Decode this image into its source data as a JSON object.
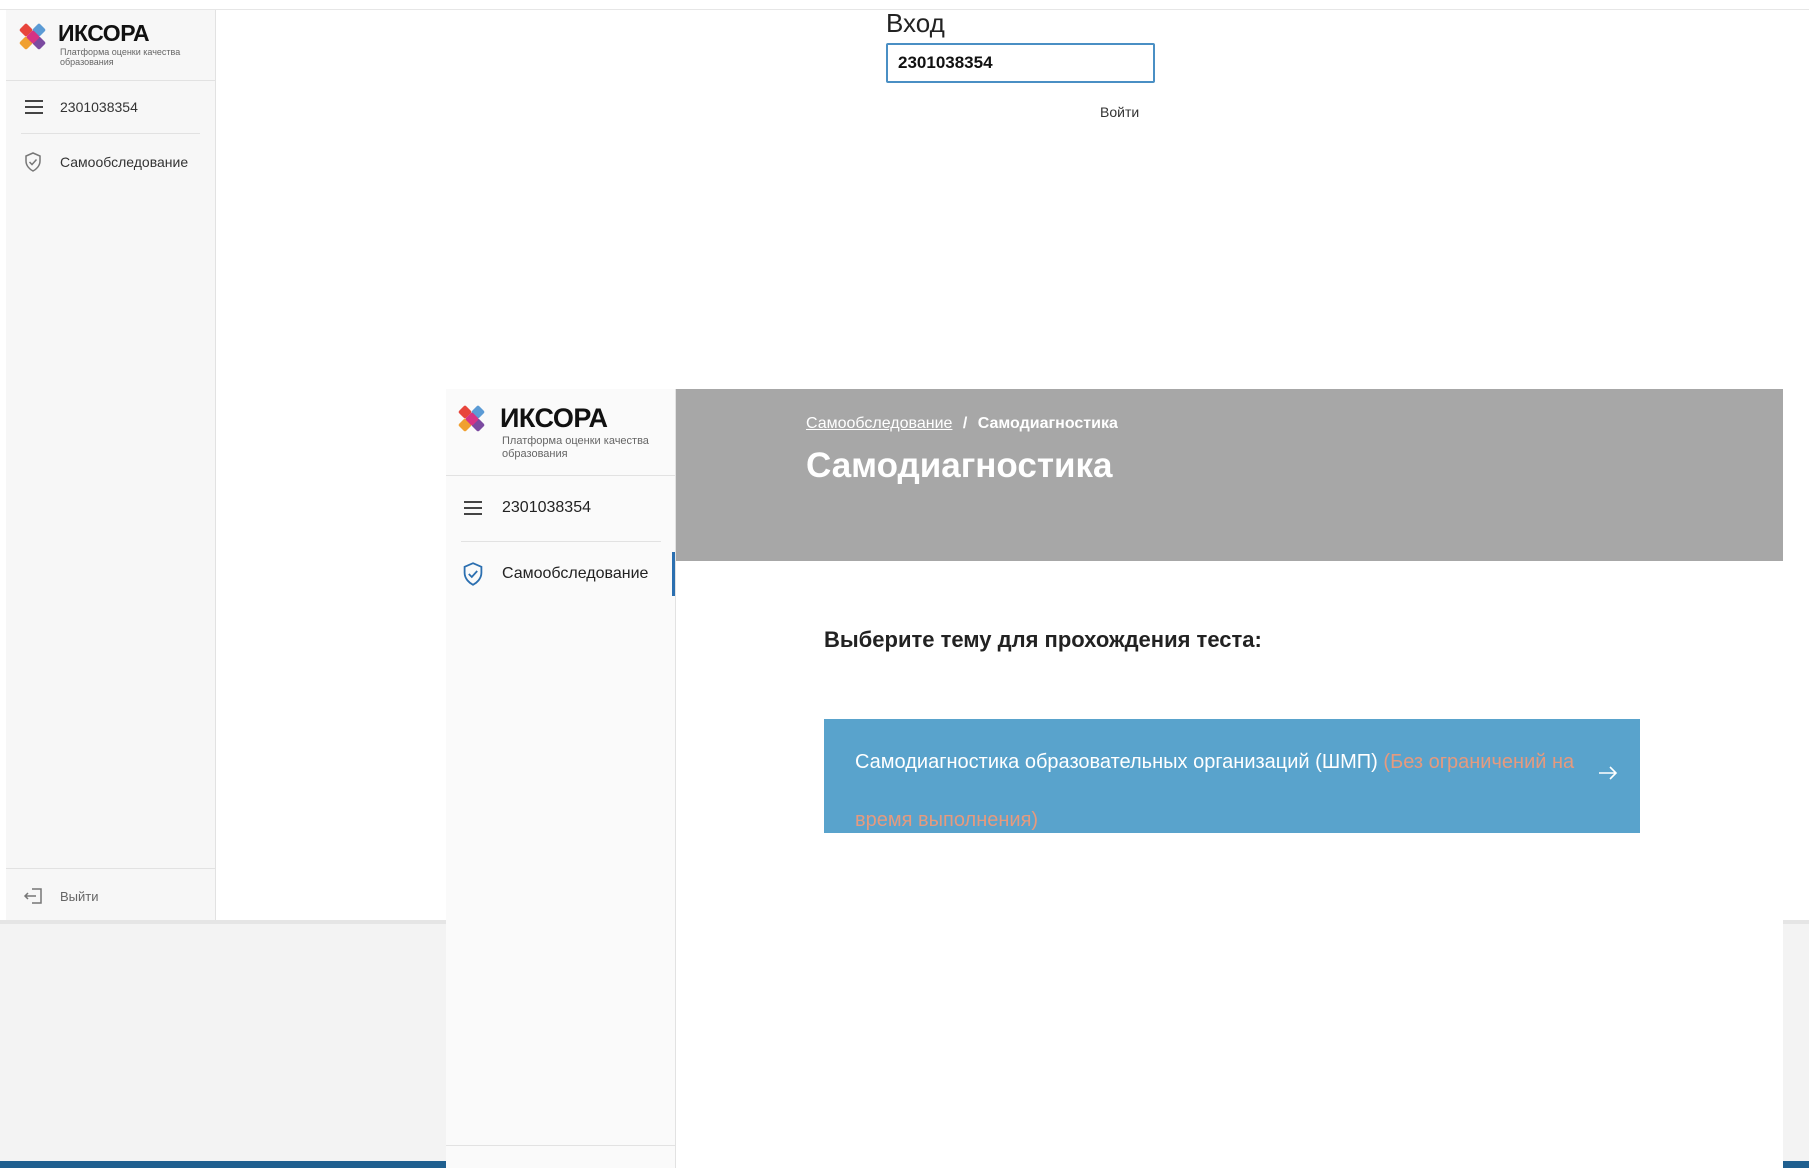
{
  "brand": {
    "name": "ИКСОРА",
    "tagline_line1": "Платформа оценки качества",
    "tagline_line2": "образования"
  },
  "background_window": {
    "sidebar": {
      "account_number": "2301038354",
      "nav_item": "Самообследование",
      "logout": "Выйти"
    },
    "login": {
      "title": "Вход",
      "input_value": "2301038354",
      "submit_label": "Войти"
    }
  },
  "foreground_window": {
    "sidebar": {
      "account_number": "2301038354",
      "nav_item": "Самообследование"
    },
    "breadcrumb": {
      "parent": "Самообследование",
      "separator": "/",
      "current": "Самодиагностика"
    },
    "page_title": "Самодиагностика",
    "prompt": "Выберите тему для прохождения теста:",
    "test_card": {
      "title": "Самодиагностика образовательных организаций (ШМП)",
      "note": "(Без ограничений на время выполнения)"
    }
  },
  "colors": {
    "header_bg": "#a7a7a7",
    "card_bg": "#59a3cc",
    "accent": "#2b6fb0",
    "note_text": "#e69a7e"
  }
}
